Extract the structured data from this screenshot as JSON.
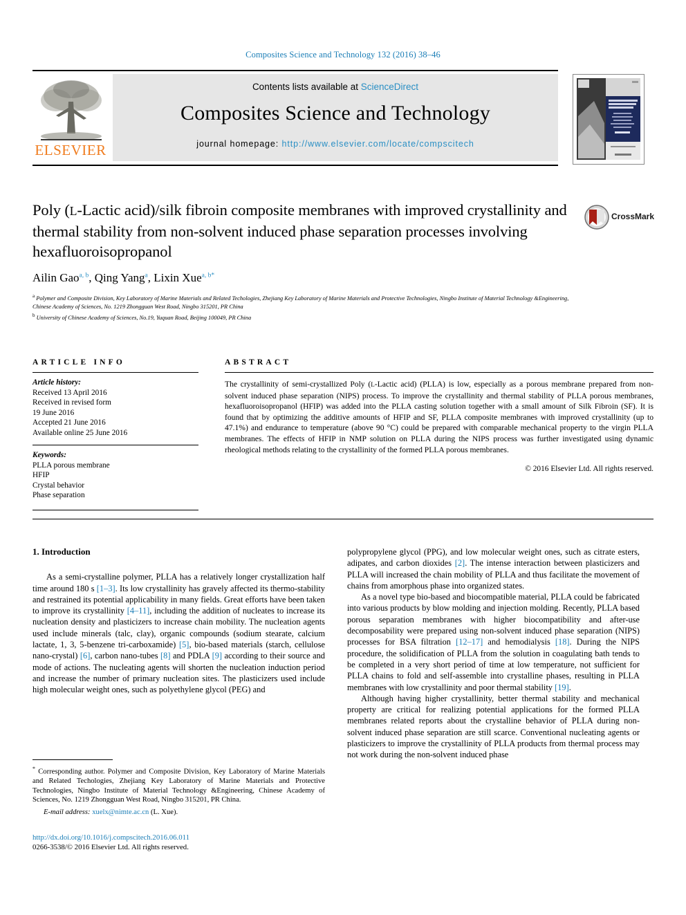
{
  "running_head": "Composites Science and Technology 132 (2016) 38–46",
  "masthead": {
    "contents_prefix": "Contents lists available at ",
    "sciencedirect": "ScienceDirect",
    "journal_title": "Composites Science and Technology",
    "homepage_prefix": "journal homepage: ",
    "homepage_url": "http://www.elsevier.com/locate/compscitech",
    "publisher": "ELSEVIER",
    "cover_title_line1": "COMPOSITES",
    "cover_title_line2": "SCIENCE AND",
    "cover_title_line3": "TECHNOLOGY"
  },
  "article": {
    "title_part1": "Poly (",
    "title_smallcap": "L",
    "title_part2": "-Lactic acid)/silk fibroin composite membranes with improved crystallinity and thermal stability from non-solvent induced phase separation processes involving hexafluoroisopropanol",
    "crossmark_label": "CrossMark"
  },
  "authors": {
    "list": [
      {
        "name": "Ailin Gao",
        "marks": "a, b",
        "sep": ", "
      },
      {
        "name": "Qing Yang",
        "marks": "a",
        "sep": ", "
      },
      {
        "name": "Lixin Xue",
        "marks": "a, b",
        "star": "*",
        "sep": ""
      }
    ],
    "affiliation_a_mark": "a",
    "affiliation_a": "Polymer and Composite Division, Key Laboratory of Marine Materials and Related Techologies, Zhejiang Key Laboratory of Marine Materials and Protective Technologies, Ningbo Institute of Material Technology &Engineering, Chinese Academy of Sciences, No. 1219 Zhongguan West Road, Ningbo 315201, PR China",
    "affiliation_b_mark": "b",
    "affiliation_b": "University of Chinese Academy of Sciences, No.19, Yuquan Road, Beijing 100049, PR China"
  },
  "article_info": {
    "heading": "ARTICLE INFO",
    "history_label": "Article history:",
    "history": [
      "Received 13 April 2016",
      "Received in revised form",
      "19 June 2016",
      "Accepted 21 June 2016",
      "Available online 25 June 2016"
    ],
    "keywords_label": "Keywords:",
    "keywords": [
      "PLLA porous membrane",
      "HFIP",
      "Crystal behavior",
      "Phase separation"
    ]
  },
  "abstract": {
    "heading": "ABSTRACT",
    "text_part1": "The crystallinity of semi-crystallized Poly (",
    "text_smallcap": "L",
    "text_part2": "-Lactic acid) (PLLA) is low, especially as a porous membrane prepared from non-solvent induced phase separation (NIPS) process. To improve the crystallinity and thermal stability of PLLA porous membranes, hexafluoroisopropanol (HFIP) was added into the PLLA casting solution together with a small amount of Silk Fibroin (SF). It is found that by optimizing the additive amounts of HFIP and SF, PLLA composite membranes with improved crystallinity (up to 47.1%) and endurance to temperature (above 90 °C) could be prepared with comparable mechanical property to the virgin PLLA membranes. The effects of HFIP in NMP solution on PLLA during the NIPS process was further investigated using dynamic rheological methods relating to the crystallinity of the formed PLLA porous membranes.",
    "copyright": "© 2016 Elsevier Ltd. All rights reserved."
  },
  "introduction": {
    "section_title": "1. Introduction",
    "left_para1": [
      {
        "t": "As a semi-crystalline polymer, PLLA has a relatively longer crystallization half time around 180 s "
      },
      {
        "t": "[1–3]",
        "r": true
      },
      {
        "t": ". Its low crystallinity has gravely affected its thermo-stability and restrained its potential applicability in many fields. Great efforts have been taken to improve its crystallinity "
      },
      {
        "t": "[4–11]",
        "r": true
      },
      {
        "t": ", including the addition of nucleates to increase its nucleation density and plasticizers to increase chain mobility. The nucleation agents used include minerals (talc, clay), organic compounds (sodium stearate, calcium lactate, 1, 3, 5-benzene tri-carboxamide) "
      },
      {
        "t": "[5]",
        "r": true
      },
      {
        "t": ", bio-based materials (starch, cellulose nano-crystal) "
      },
      {
        "t": "[6]",
        "r": true
      },
      {
        "t": ", carbon nano-tubes "
      },
      {
        "t": "[8]",
        "r": true
      },
      {
        "t": " and PDLA "
      },
      {
        "t": "[9]",
        "r": true
      },
      {
        "t": " according to their source and mode of actions. The nucleating agents will shorten the nucleation induction period and increase the number of primary nucleation sites. The plasticizers used include high molecular weight ones, such as polyethylene glycol (PEG) and"
      }
    ],
    "right_para1": [
      {
        "t": "polypropylene glycol (PPG), and low molecular weight ones, such as citrate esters, adipates, and carbon dioxides "
      },
      {
        "t": "[2]",
        "r": true
      },
      {
        "t": ". The intense interaction between plasticizers and PLLA will increased the chain mobility of PLLA and thus facilitate the movement of chains from amorphous phase into organized states."
      }
    ],
    "right_para2": [
      {
        "t": "As a novel type bio-based and biocompatible material, PLLA could be fabricated into various products by blow molding and injection molding. Recently, PLLA based porous separation membranes with higher biocompatibility and after-use decomposability were prepared using non-solvent induced phase separation (NIPS) processes for BSA filtration "
      },
      {
        "t": "[12–17]",
        "r": true
      },
      {
        "t": " and hemodialysis "
      },
      {
        "t": "[18]",
        "r": true
      },
      {
        "t": ". During the NIPS procedure, the solidification of PLLA from the solution in coagulating bath tends to be completed in a very short period of time at low temperature, not sufficient for PLLA chains to fold and self-assemble into crystalline phases, resulting in PLLA membranes with low crystallinity and poor thermal stability "
      },
      {
        "t": "[19]",
        "r": true
      },
      {
        "t": "."
      }
    ],
    "right_para3": [
      {
        "t": "Although having higher crystallinity, better thermal stability and mechanical property are critical for realizing potential applications for the formed PLLA membranes related reports about the crystalline behavior of PLLA during non-solvent induced phase separation are still scarce. Conventional nucleating agents or plasticizers to improve the crystallinity of PLLA products from thermal process may not work during the non-solvent induced phase"
      }
    ]
  },
  "footnote": {
    "star": "*",
    "text": " Corresponding author. Polymer and Composite Division, Key Laboratory of Marine Materials and Related Techologies, Zhejiang Key Laboratory of Marine Materials and Protective Technologies, Ningbo Institute of Material Technology &Engineering, Chinese Academy of Sciences, No. 1219 Zhongguan West Road, Ningbo 315201, PR China.",
    "email_label": "E-mail address:",
    "email": "xuelx@nimte.ac.cn",
    "email_suffix": "(L. Xue)."
  },
  "imprint": {
    "doi": "http://dx.doi.org/10.1016/j.compscitech.2016.06.011",
    "issn_line": "0266-3538/© 2016 Elsevier Ltd. All rights reserved."
  },
  "colors": {
    "link": "#1a7db6",
    "sciencedirect": "#2a8fc4",
    "elsevier_orange": "#f07c1e",
    "masthead_bg": "#e6e6e6"
  }
}
